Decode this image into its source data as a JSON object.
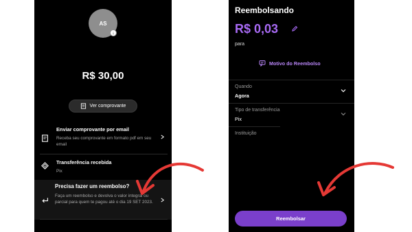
{
  "left": {
    "avatar_initials": "AS",
    "amount": "R$ 30,00",
    "receipt_button": "Ver comprovante",
    "rows": [
      {
        "title": "Enviar comprovante por email",
        "desc": "Receba seu comprovante em formato pdf em seu email"
      },
      {
        "title": "Transferência recebida",
        "desc": "Pix"
      },
      {
        "title": "Precisa fazer um reembolso?",
        "desc": "Faça um reembolso e devolva o valor integral ou parcial para quem te pagou até o dia 19 SET 2023."
      }
    ]
  },
  "right": {
    "title": "Reembolsando",
    "amount": "R$ 0,03",
    "para_label": "para",
    "motivo_link": "Motivo do Reembolso",
    "fields": [
      {
        "label": "Quando",
        "value": "Agora"
      },
      {
        "label": "Tipo de transferência",
        "value": "Pix"
      },
      {
        "label": "Instituição",
        "value": ""
      }
    ],
    "submit_button": "Reembolsar"
  },
  "colors": {
    "accent": "#a96bf6",
    "button": "#7a3fcb",
    "annotation": "#e53935"
  }
}
